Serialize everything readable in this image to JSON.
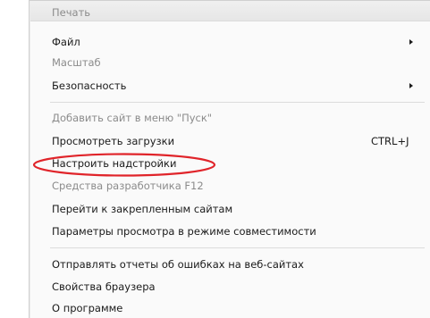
{
  "menu": {
    "items": [
      {
        "label": "Печать",
        "disabled": true
      },
      {
        "label": "Файл",
        "submenu": true
      },
      {
        "label": "Масштаб",
        "disabled": true
      },
      {
        "label": "Безопасность",
        "submenu": true
      },
      {
        "label": "Добавить сайт в меню \"Пуск\"",
        "disabled": true
      },
      {
        "label": "Просмотреть загрузки",
        "shortcut": "CTRL+J"
      },
      {
        "label": "Настроить надстройки"
      },
      {
        "label": "Средства разработчика F12",
        "disabled": true
      },
      {
        "label": "Перейти к закрепленным сайтам"
      },
      {
        "label": "Параметры просмотра в режиме совместимости"
      },
      {
        "label": "Отправлять отчеты об ошибках на веб-сайтах"
      },
      {
        "label": "Свойства браузера"
      },
      {
        "label": "О программе"
      }
    ]
  },
  "colors": {
    "annotation": "#e0242a",
    "disabled_text": "#8b8b8b"
  }
}
